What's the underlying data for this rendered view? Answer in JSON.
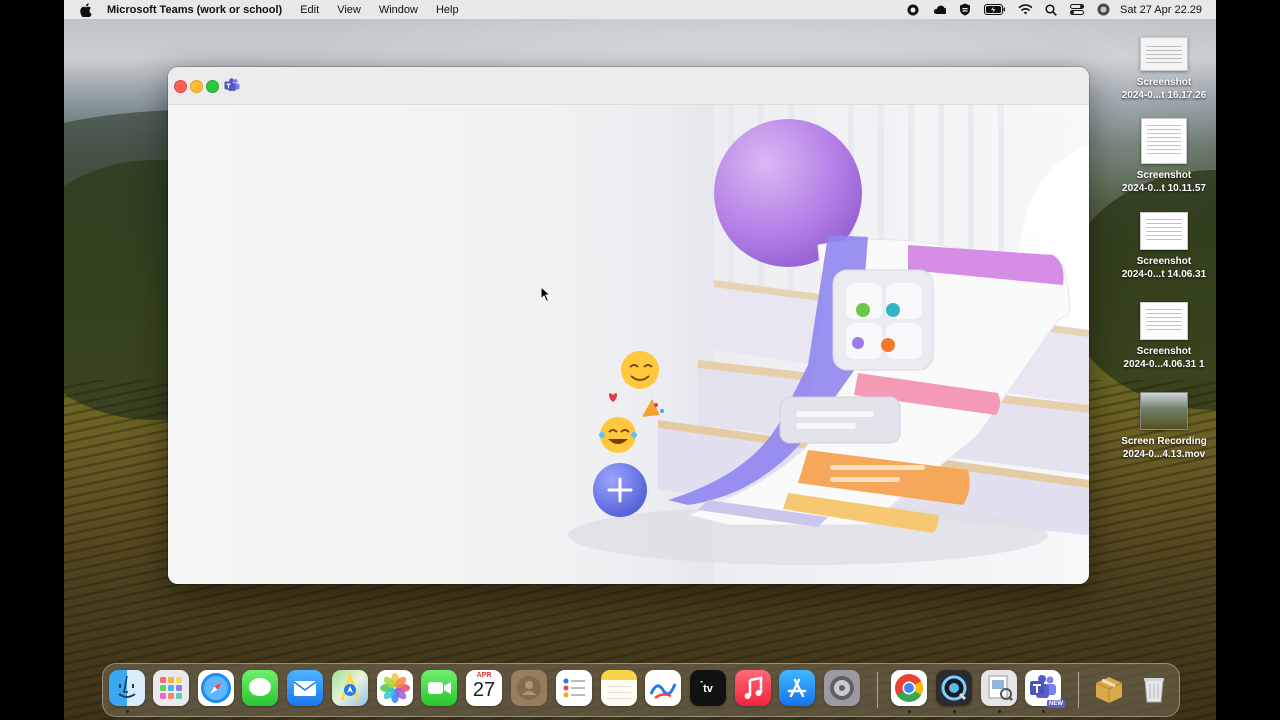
{
  "menubar": {
    "app_name": "Microsoft Teams (work or school)",
    "menus": [
      "Edit",
      "View",
      "Window",
      "Help"
    ],
    "clock": "Sat 27 Apr  22.29"
  },
  "window": {
    "title_icon": "teams-icon",
    "content_state": "loading splash illustration"
  },
  "desktop": {
    "items": [
      {
        "line1": "Screenshot",
        "line2": "2024-0...t 16.17.26",
        "kind": "screenshot"
      },
      {
        "line1": "Screenshot",
        "line2": "2024-0...t 10.11.57",
        "kind": "screenshot"
      },
      {
        "line1": "Screenshot",
        "line2": "2024-0...t 14.06.31",
        "kind": "screenshot"
      },
      {
        "line1": "Screenshot",
        "line2": "2024-0...4.06.31 1",
        "kind": "screenshot"
      },
      {
        "line1": "Screen Recording",
        "line2": "2024-0...4.13.mov",
        "kind": "recording"
      }
    ]
  },
  "dock": {
    "calendar_month": "APR",
    "calendar_day": "27",
    "teams_badge": "NEW",
    "apps": [
      "Finder",
      "Launchpad",
      "Safari",
      "Messages",
      "Mail",
      "Maps",
      "Photos",
      "FaceTime",
      "Calendar",
      "Contacts",
      "Reminders",
      "Notes",
      "Freeform",
      "TV",
      "Music",
      "App Store",
      "System Settings",
      "Google Chrome",
      "QuickTime Player",
      "Preview",
      "Microsoft Teams",
      "Archive Utility",
      "Trash"
    ]
  },
  "colors": {
    "close": "#ff5f57",
    "minimize": "#febc2e",
    "maximize": "#28c840",
    "teams_purple": "#5b5fc7"
  }
}
